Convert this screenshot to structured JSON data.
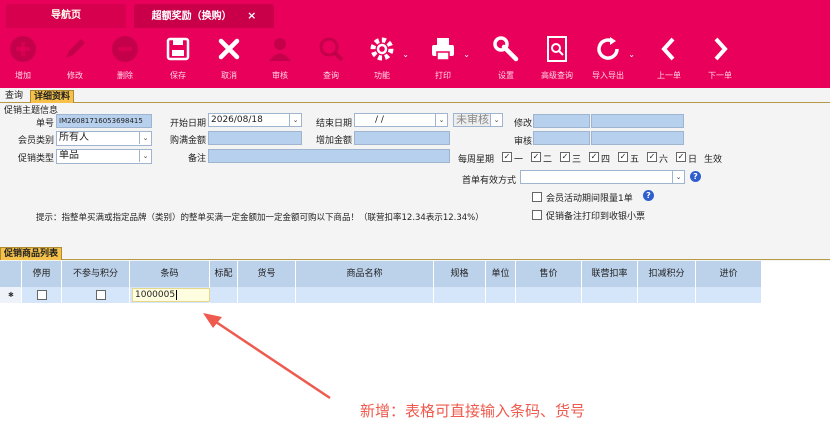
{
  "tabs": {
    "nav": "导航页",
    "active": "超额奖励（换购）",
    "close": "×"
  },
  "toolbar": [
    {
      "key": "add",
      "label": "增加",
      "icon": "plus-circle-icon",
      "disabled": true
    },
    {
      "key": "edit",
      "label": "修改",
      "icon": "pencil-icon",
      "disabled": true
    },
    {
      "key": "delete",
      "label": "删除",
      "icon": "minus-circle-icon",
      "disabled": true
    },
    {
      "key": "save",
      "label": "保存",
      "icon": "floppy-disk-icon",
      "disabled": false
    },
    {
      "key": "cancel",
      "label": "取消",
      "icon": "x-cross-icon",
      "disabled": false
    },
    {
      "key": "audit",
      "label": "审核",
      "icon": "person-icon",
      "disabled": true
    },
    {
      "key": "query",
      "label": "查询",
      "icon": "magnifier-icon",
      "disabled": true
    },
    {
      "key": "function",
      "label": "功能",
      "icon": "gear-icon",
      "disabled": false
    },
    {
      "key": "print",
      "label": "打印",
      "icon": "printer-icon",
      "disabled": false
    },
    {
      "key": "settings",
      "label": "设置",
      "icon": "wrench-icon",
      "disabled": false
    },
    {
      "key": "adv_query",
      "label": "高级查询",
      "icon": "document-search-icon",
      "disabled": false
    },
    {
      "key": "import_export",
      "label": "导入导出",
      "icon": "refresh-icon",
      "disabled": false
    },
    {
      "key": "prev",
      "label": "上一单",
      "icon": "chevron-left-icon",
      "disabled": false
    },
    {
      "key": "next",
      "label": "下一单",
      "icon": "chevron-right-icon",
      "disabled": false
    }
  ],
  "subtabs": {
    "query": "查询",
    "detail": "详细资料"
  },
  "form": {
    "section": "促销主题信息",
    "order_no_label": "单号",
    "order_no": "IM26081716053698415",
    "member_label": "会员类别",
    "member_value": "所有人",
    "promo_type_label": "促销类型",
    "promo_type_value": "单品",
    "start_label": "开始日期",
    "start_value": "2026/08/18",
    "end_label": "结束日期",
    "end_value": "/ /",
    "full_amount_label": "购满金额",
    "add_amount_label": "增加金额",
    "note_label": "备注",
    "status_value": "未审核",
    "modify_label": "修改",
    "audit_label": "审核",
    "weekly_label": "每周星期",
    "weekdays": [
      "一",
      "二",
      "三",
      "四",
      "五",
      "六",
      "日"
    ],
    "effective_label": "生效",
    "first_order_label": "首单有效方式",
    "limit_label": "会员活动期间限量1单",
    "print_note_label": "促销备注打印到收银小票",
    "help": "?"
  },
  "tip": "提示：指整单买满或指定品牌（类别）的整单买满一定金额加一定金额可购以下商品！（联营扣率12.34表示12.34%）",
  "grid": {
    "title": "促销商品列表",
    "columns": [
      "停用",
      "不参与积分",
      "条码",
      "标配",
      "货号",
      "商品名称",
      "规格",
      "单位",
      "售价",
      "联营扣率",
      "扣减积分",
      "进价"
    ],
    "row_marker": "✱",
    "barcode_input": "1000005"
  },
  "annotation": "新增：表格可直接输入条码、货号",
  "colors": {
    "brand": "#e8005a",
    "annotation": "#ef5a4e",
    "highlight": "#f6c14a"
  }
}
